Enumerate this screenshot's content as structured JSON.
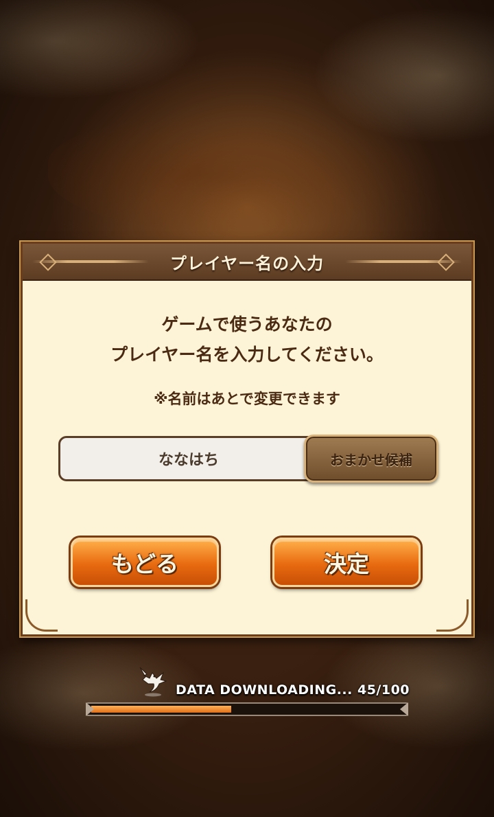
{
  "dialog": {
    "title": "プレイヤー名の入力",
    "message_line1": "ゲームで使うあなたの",
    "message_line2": "プレイヤー名を入力してください。",
    "note": "※名前はあとで変更できます",
    "name_value": "ななはち",
    "suggest_label": "おまかせ候補",
    "back_label": "もどる",
    "confirm_label": "決定"
  },
  "download": {
    "label": "DATA DOWNLOADING... 45/100",
    "progress": 0.45
  },
  "colors": {
    "accent_orange": "#e86a10",
    "dialog_bg": "#fdf3d6",
    "header_brown": "#6b4628"
  },
  "icons": {
    "loading": "dragon-icon"
  }
}
